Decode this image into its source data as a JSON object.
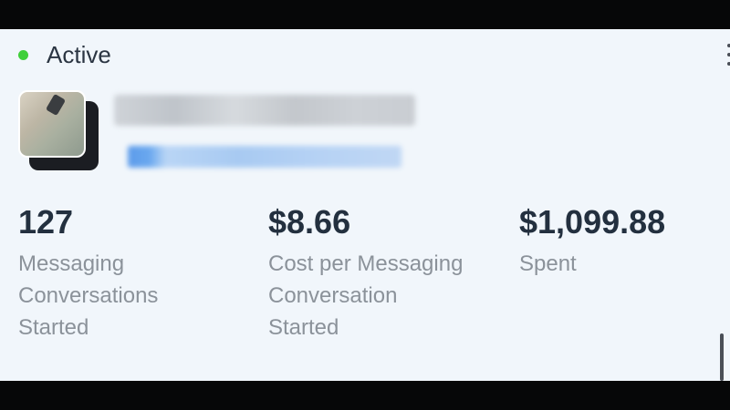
{
  "status": {
    "label": "Active",
    "color": "#3fcf3a"
  },
  "menu": {
    "icon": "more-vertical-icon"
  },
  "ad": {
    "thumbnail_icon": "ad-image-thumbnail"
  },
  "metrics": [
    {
      "value": "127",
      "label": "Messaging\nConversations\nStarted"
    },
    {
      "value": "$8.66",
      "label": "Cost per Messaging\nConversation\nStarted"
    },
    {
      "value": "$1,099.88",
      "label": "Spent"
    }
  ]
}
